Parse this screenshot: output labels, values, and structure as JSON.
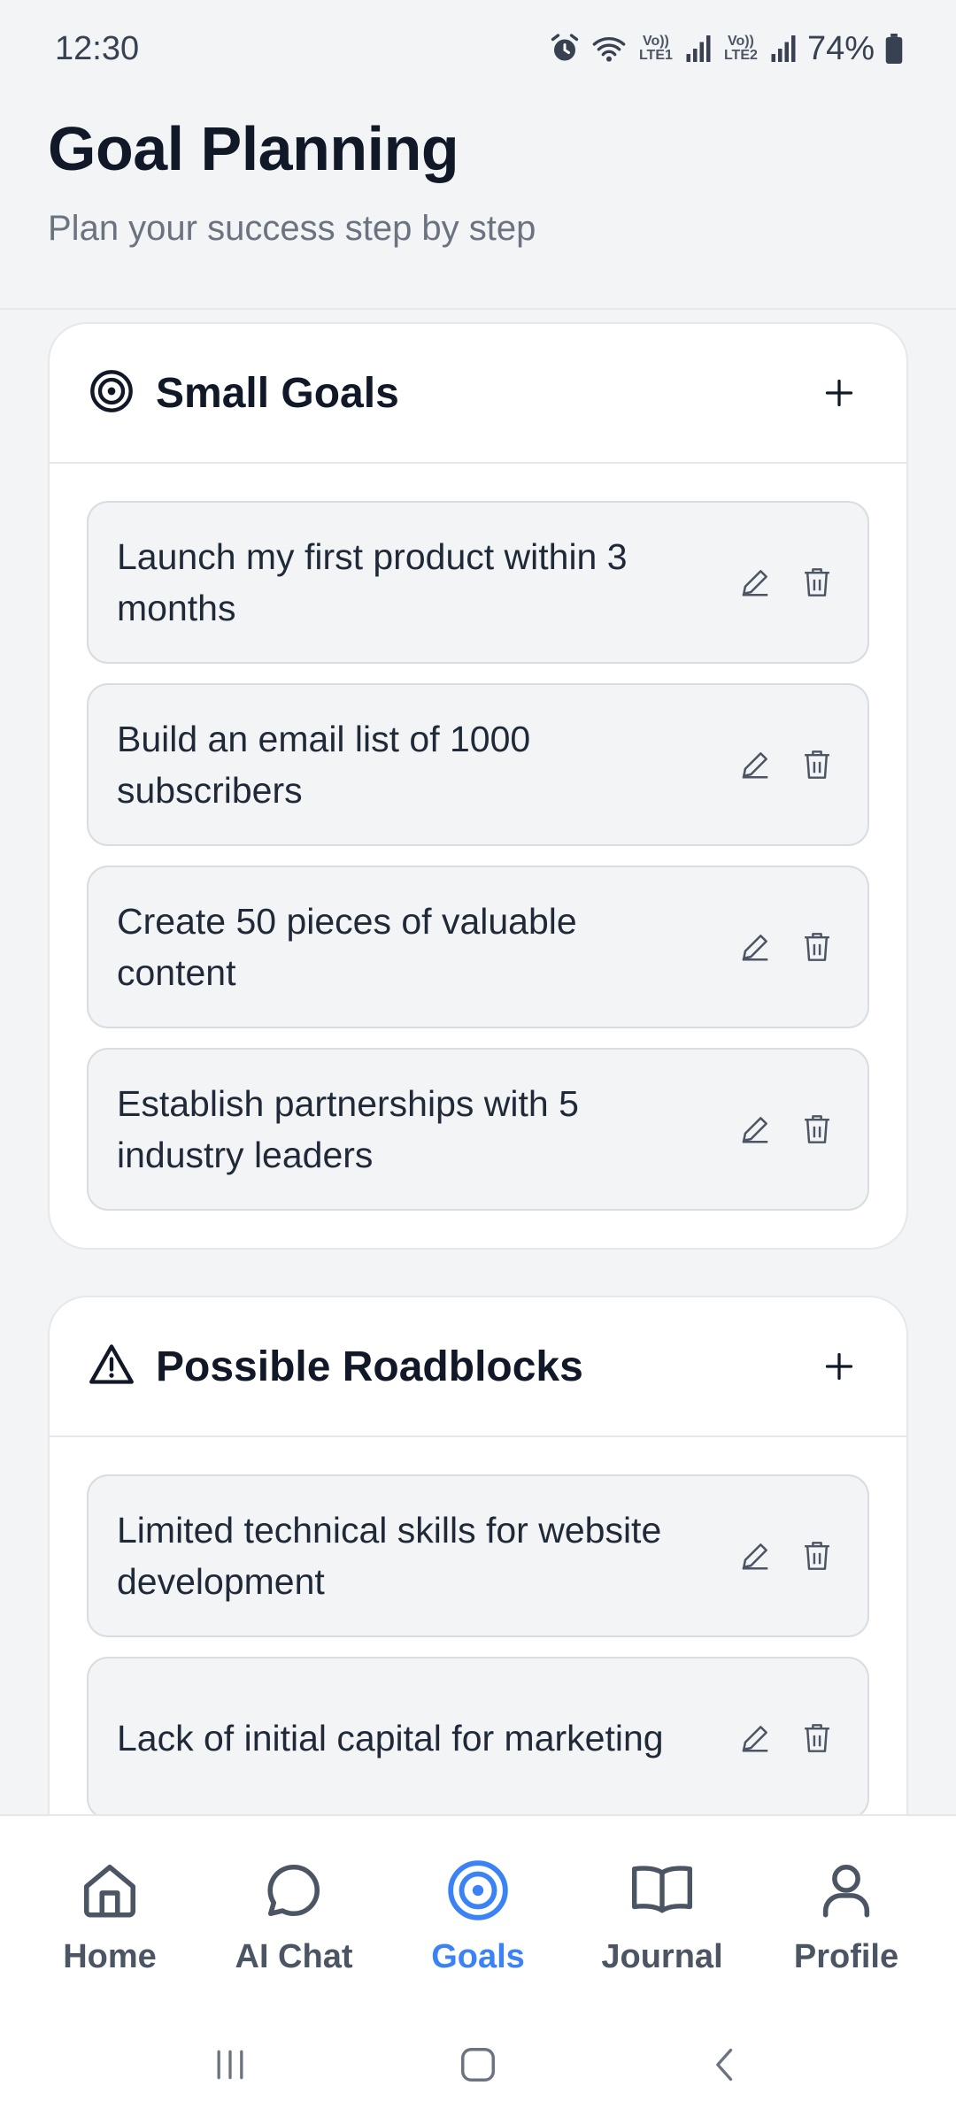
{
  "status_bar": {
    "time": "12:30",
    "battery": "74%",
    "sim1": "Vo)) LTE1",
    "sim2": "Vo)) LTE2",
    "icons": [
      "alarm-icon",
      "wifi-icon",
      "signal-icon",
      "battery-icon"
    ]
  },
  "header": {
    "title": "Goal Planning",
    "subtitle": "Plan your success step by step"
  },
  "sections": {
    "small_goals": {
      "title": "Small Goals",
      "icon": "target-icon",
      "add_label": "+",
      "items": [
        {
          "text": "Launch my first product within 3 months"
        },
        {
          "text": "Build an email list of 1000 subscribers"
        },
        {
          "text": "Create 50 pieces of valuable content"
        },
        {
          "text": "Establish partnerships with 5 industry leaders"
        }
      ]
    },
    "roadblocks": {
      "title": "Possible Roadblocks",
      "icon": "warning-icon",
      "add_label": "+",
      "items": [
        {
          "text": "Limited technical skills for website development"
        },
        {
          "text": "Lack of initial capital for marketing"
        }
      ]
    }
  },
  "bottom_nav": {
    "items": [
      {
        "label": "Home",
        "icon": "home-icon",
        "active": false
      },
      {
        "label": "AI Chat",
        "icon": "chat-bubble-icon",
        "active": false
      },
      {
        "label": "Goals",
        "icon": "target-icon",
        "active": true
      },
      {
        "label": "Journal",
        "icon": "book-icon",
        "active": false
      },
      {
        "label": "Profile",
        "icon": "user-icon",
        "active": false
      }
    ]
  },
  "colors": {
    "accent": "#3b82f6",
    "background": "#f3f4f6",
    "card": "#ffffff",
    "text_primary": "#111827",
    "text_secondary": "#6b7280",
    "nav_inactive": "#4b5563"
  }
}
